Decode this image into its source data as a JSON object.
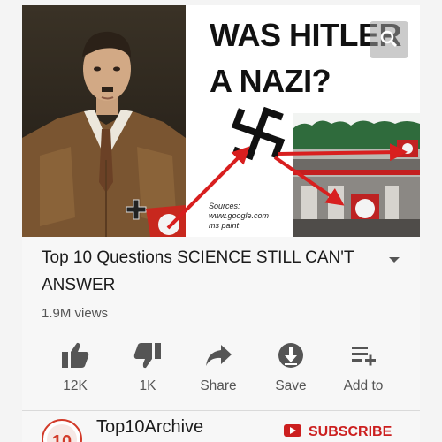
{
  "thumbnail": {
    "headline_lines": [
      "WAS HITLER",
      "A NAZI?"
    ],
    "sources_lines": [
      "Sources:",
      "www.google.com",
      "ms paint"
    ]
  },
  "video": {
    "title": "Top 10 Questions SCIENCE STILL CAN'T ANSWER",
    "views": "1.9M views"
  },
  "actions": {
    "like": "12K",
    "dislike": "1K",
    "share": "Share",
    "save": "Save",
    "add_to": "Add to"
  },
  "channel": {
    "name": "Top10Archive",
    "avatar_text": "10",
    "subscribe": "SUBSCRIBE"
  },
  "colors": {
    "accent_red": "#cc1f1f",
    "icon_gray": "#555555",
    "arrow_red": "#d81f1f"
  },
  "icons": [
    "zoom-icon",
    "swastika-icon",
    "like-icon",
    "dislike-icon",
    "share-icon",
    "save-icon",
    "add-to-playlist-icon",
    "chevron-down-icon",
    "youtube-icon"
  ]
}
